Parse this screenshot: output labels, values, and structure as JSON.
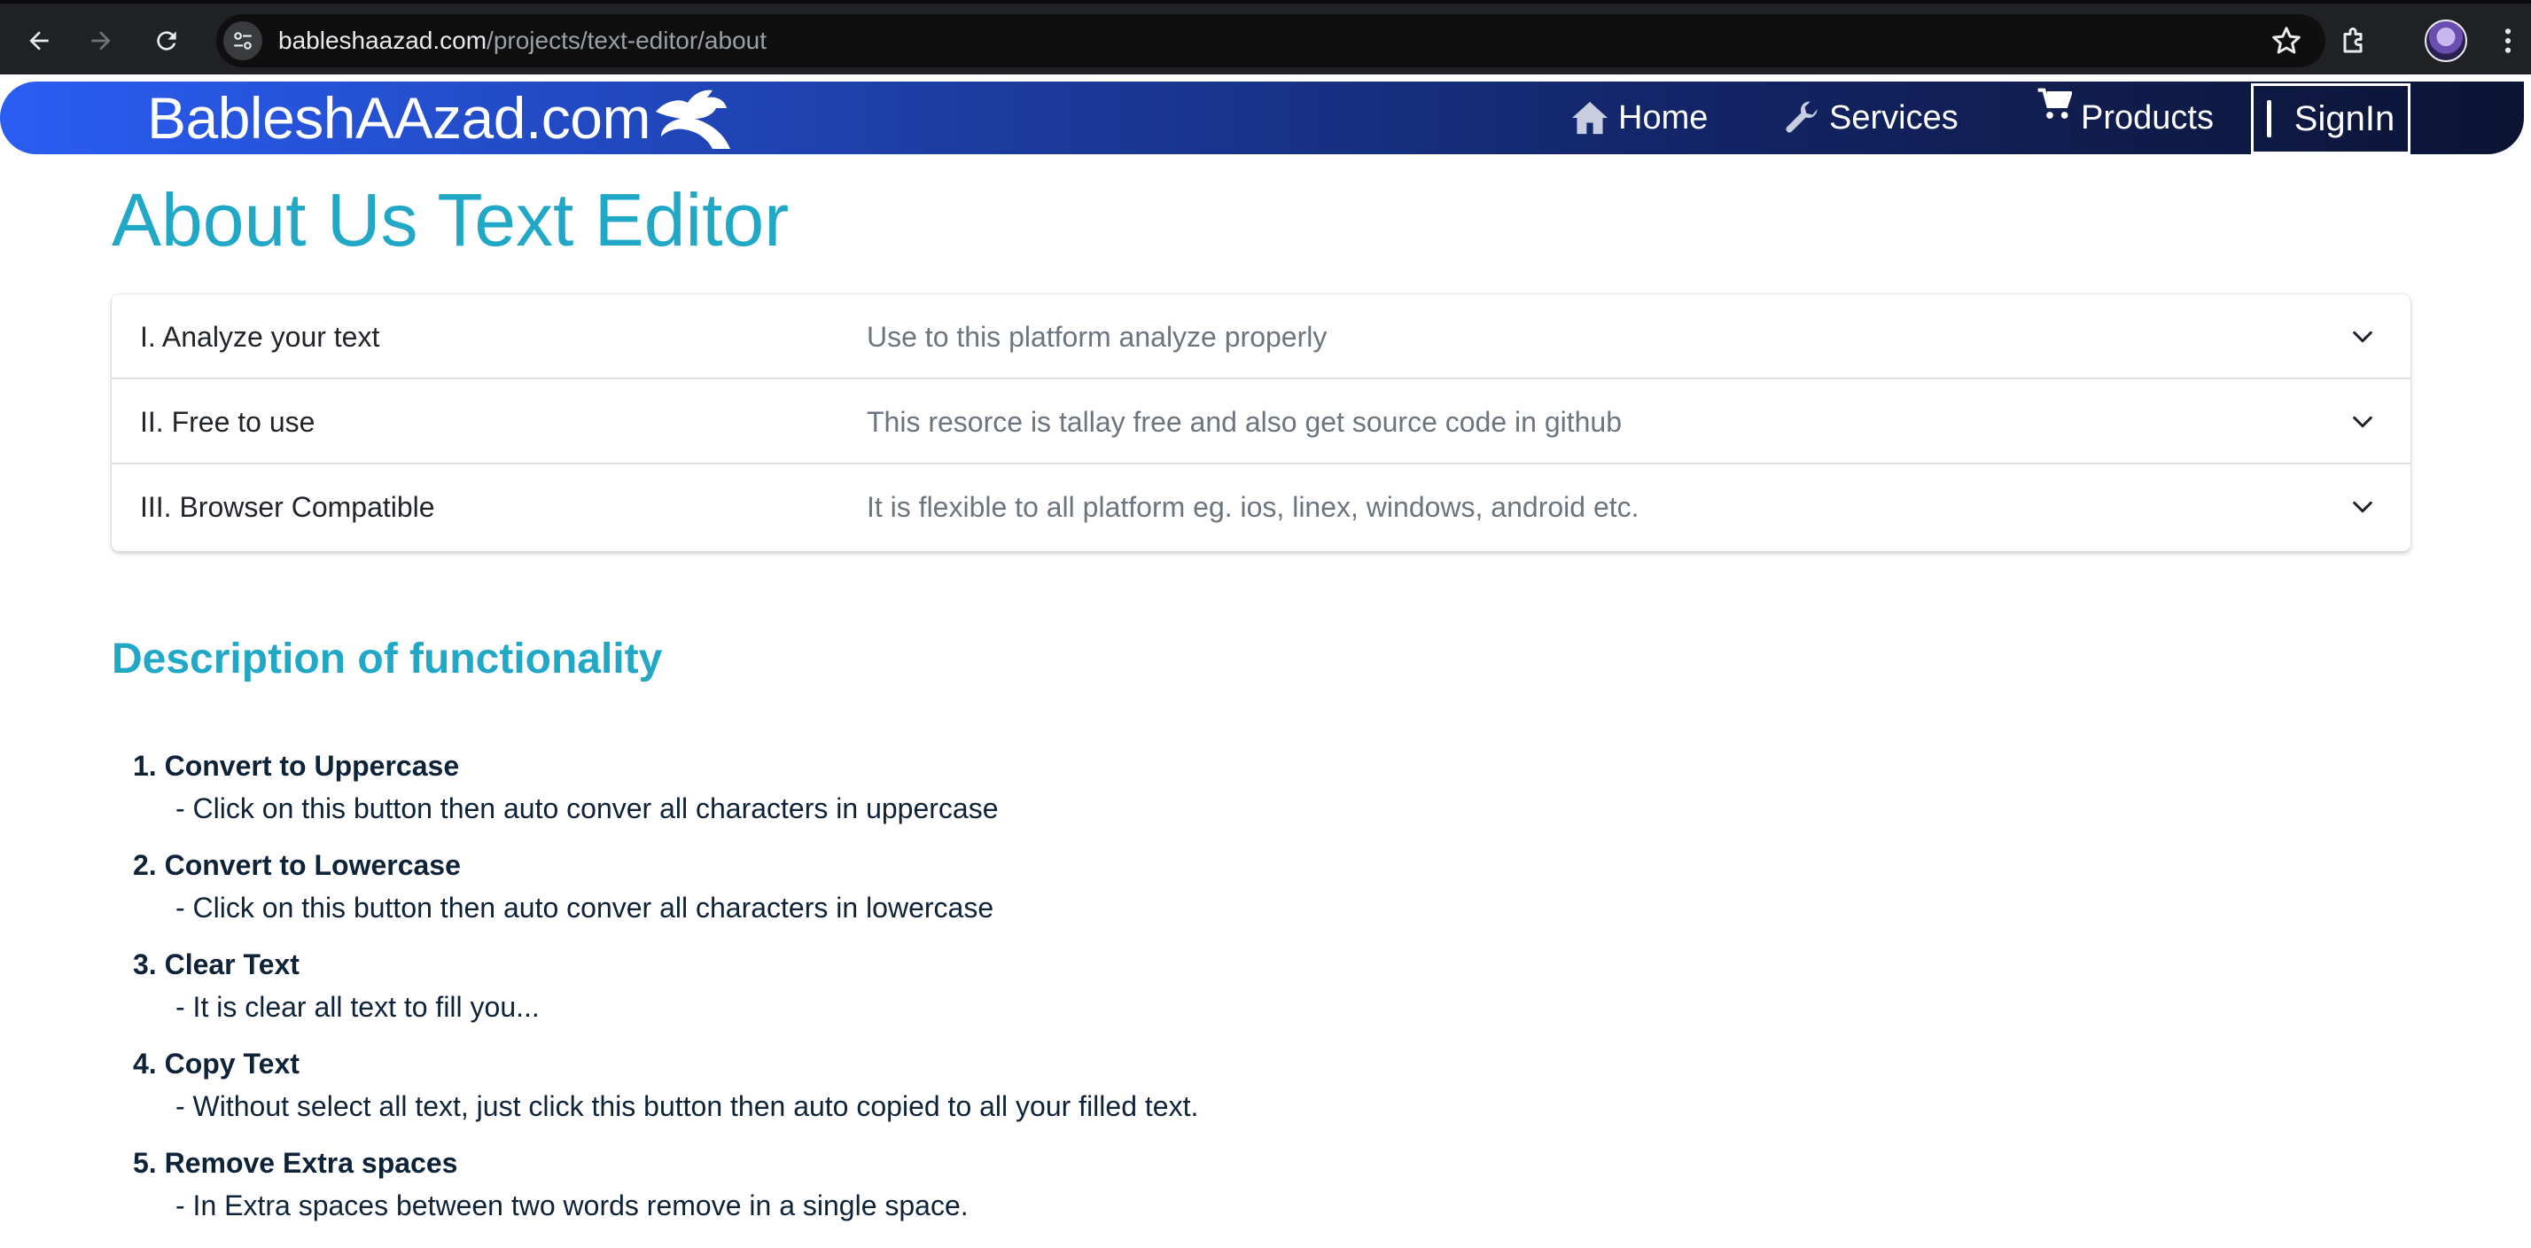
{
  "browser": {
    "url_domain": "bableshaazad.com",
    "url_path": "/projects/text-editor/about",
    "icons": [
      "back-icon",
      "forward-icon",
      "reload-icon",
      "site-info-icon",
      "bookmark-star-icon",
      "extensions-icon",
      "profile-avatar",
      "menu-icon"
    ]
  },
  "header": {
    "brand": "BableshAAzad.com",
    "nav": {
      "home": "Home",
      "services": "Services",
      "products": "Products",
      "signin": "SignIn"
    }
  },
  "main": {
    "title": "About Us Text Editor",
    "accordion": [
      {
        "title": "I. Analyze your text",
        "desc": "Use to this platform analyze properly"
      },
      {
        "title": "II. Free to use",
        "desc": "This resorce is tallay free and also get source code in github"
      },
      {
        "title": "III. Browser Compatible",
        "desc": "It is flexible to all platform eg. ios, linex, windows, android etc."
      }
    ],
    "section_title": "Description of functionality",
    "features": [
      {
        "title": "1. Convert to Uppercase",
        "desc": "- Click on this button then auto conver all characters in uppercase"
      },
      {
        "title": "2. Convert to Lowercase",
        "desc": "- Click on this button then auto conver all characters in lowercase"
      },
      {
        "title": "3. Clear Text",
        "desc": "- It is clear all text to fill you..."
      },
      {
        "title": "4. Copy Text",
        "desc": "- Without select all text, just click this button then auto copied to all your filled text."
      },
      {
        "title": "5. Remove Extra spaces",
        "desc": "- In Extra spaces between two words remove in a single space."
      }
    ]
  },
  "colors": {
    "accent": "#22a8c7",
    "header_start": "#2a5df2",
    "header_end": "#0c1433",
    "text_dark": "#0e2238"
  }
}
